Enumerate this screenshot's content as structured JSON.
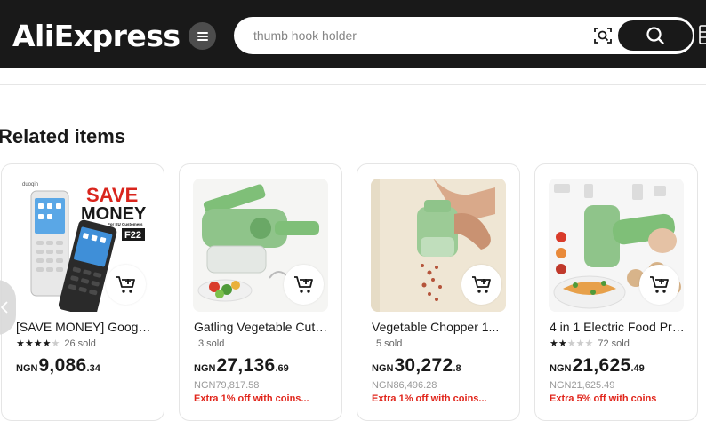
{
  "header": {
    "logo_text": "AliExpress",
    "logo_accent_color": "#f7a31f",
    "menu_icon": "hamburger-menu-icon",
    "search_placeholder": "thumb hook holder",
    "camera_icon": "image-search-icon",
    "search_icon": "search-icon"
  },
  "section": {
    "title": "Related items"
  },
  "products": [
    {
      "title": "[SAVE MONEY] Google...",
      "rating": 4.5,
      "sold": "26 sold",
      "currency": "NGN",
      "price_main": "9,086",
      "price_dec": ".34",
      "old_price": "",
      "promo": "",
      "image_text": {
        "brand": "duoqin",
        "line1": "SAVE",
        "line2": "MONEY",
        "line3": "For EU Customers",
        "model": "F22"
      }
    },
    {
      "title": "Gatling Vegetable Cutter",
      "rating": 0,
      "sold": "3 sold",
      "currency": "NGN",
      "price_main": "27,136",
      "price_dec": ".69",
      "old_price": "NGN79,817.58",
      "promo": "Extra 1% off with coins..."
    },
    {
      "title": "Vegetable Chopper 1...",
      "rating": 0,
      "sold": "5 sold",
      "currency": "NGN",
      "price_main": "30,272",
      "price_dec": ".8",
      "old_price": "NGN86,496.28",
      "promo": "Extra 1% off with coins..."
    },
    {
      "title": "4 in 1 Electric Food Processor",
      "rating": 2.5,
      "sold": "72 sold",
      "currency": "NGN",
      "price_main": "21,625",
      "price_dec": ".49",
      "old_price": "NGN21,625.49",
      "promo": "Extra 5% off with coins"
    }
  ],
  "colors": {
    "topbar": "#191919",
    "promo": "#e1251b",
    "chopper_green": "#8fc48a"
  }
}
